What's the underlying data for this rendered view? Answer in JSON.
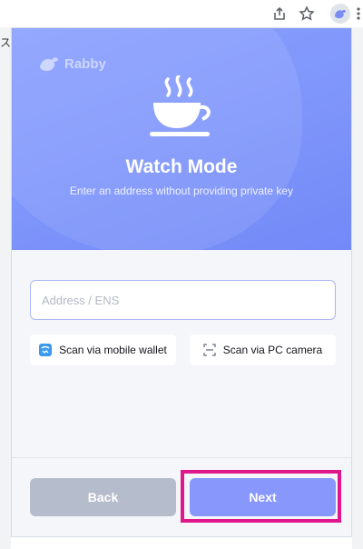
{
  "browser": {
    "page_fragment": "ス",
    "icons": [
      "share-icon",
      "star-icon",
      "rabby-extension-icon",
      "more-icon"
    ]
  },
  "popup": {
    "logo_text": "Rabby",
    "title": "Watch Mode",
    "subtitle": "Enter an address without providing private key",
    "address_input": {
      "value": "",
      "placeholder": "Address / ENS"
    },
    "scan_mobile_label": "Scan via mobile wallet",
    "scan_pc_label": "Scan via PC camera",
    "back_label": "Back",
    "next_label": "Next"
  },
  "colors": {
    "header": "#7e95fb",
    "next_button": "#8797fc",
    "back_button": "#b5bccb",
    "highlight": "#e0168b"
  }
}
